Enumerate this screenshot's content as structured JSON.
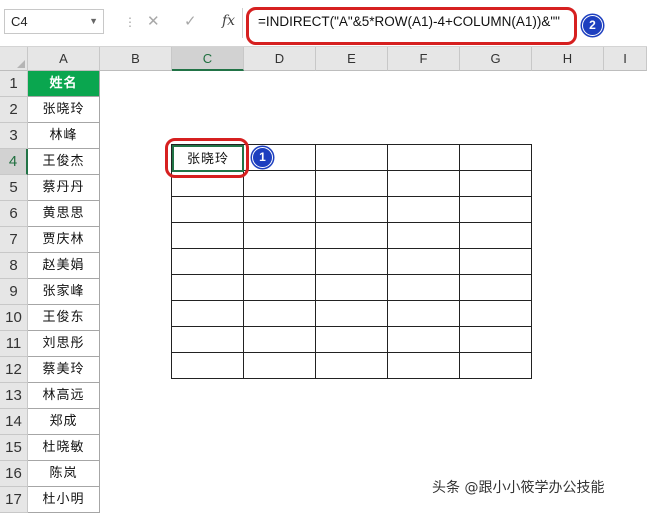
{
  "formula_bar": {
    "name_box": "C4",
    "cancel_icon": "✕",
    "enter_icon": "✓",
    "fx_label": "fx",
    "formula": "=INDIRECT(\"A\"&5*ROW(A1)-4+COLUMN(A1))&\"\""
  },
  "columns": [
    "A",
    "B",
    "C",
    "D",
    "E",
    "F",
    "G",
    "H",
    "I"
  ],
  "rows": [
    "1",
    "2",
    "3",
    "4",
    "5",
    "6",
    "7",
    "8",
    "9",
    "10",
    "11",
    "12",
    "13",
    "14",
    "15",
    "16",
    "17"
  ],
  "column_a": {
    "header": "姓名",
    "names": [
      "张晓玲",
      "林峰",
      "王俊杰",
      "蔡丹丹",
      "黄思思",
      "贾庆林",
      "赵美娟",
      "张家峰",
      "王俊东",
      "刘思彤",
      "蔡美玲",
      "林高远",
      "郑成",
      "杜晓敏",
      "陈岚",
      "杜小明"
    ]
  },
  "result_cell": {
    "address": "C4",
    "value": "张晓玲"
  },
  "badges": {
    "cell_badge": "1",
    "formula_badge": "2"
  },
  "colors": {
    "header_green": "#0aa64f",
    "select_green": "#217346",
    "annotation_red": "#d62020",
    "badge_blue": "#1d3fbf"
  },
  "watermark": "头条 @跟小小筱学办公技能"
}
